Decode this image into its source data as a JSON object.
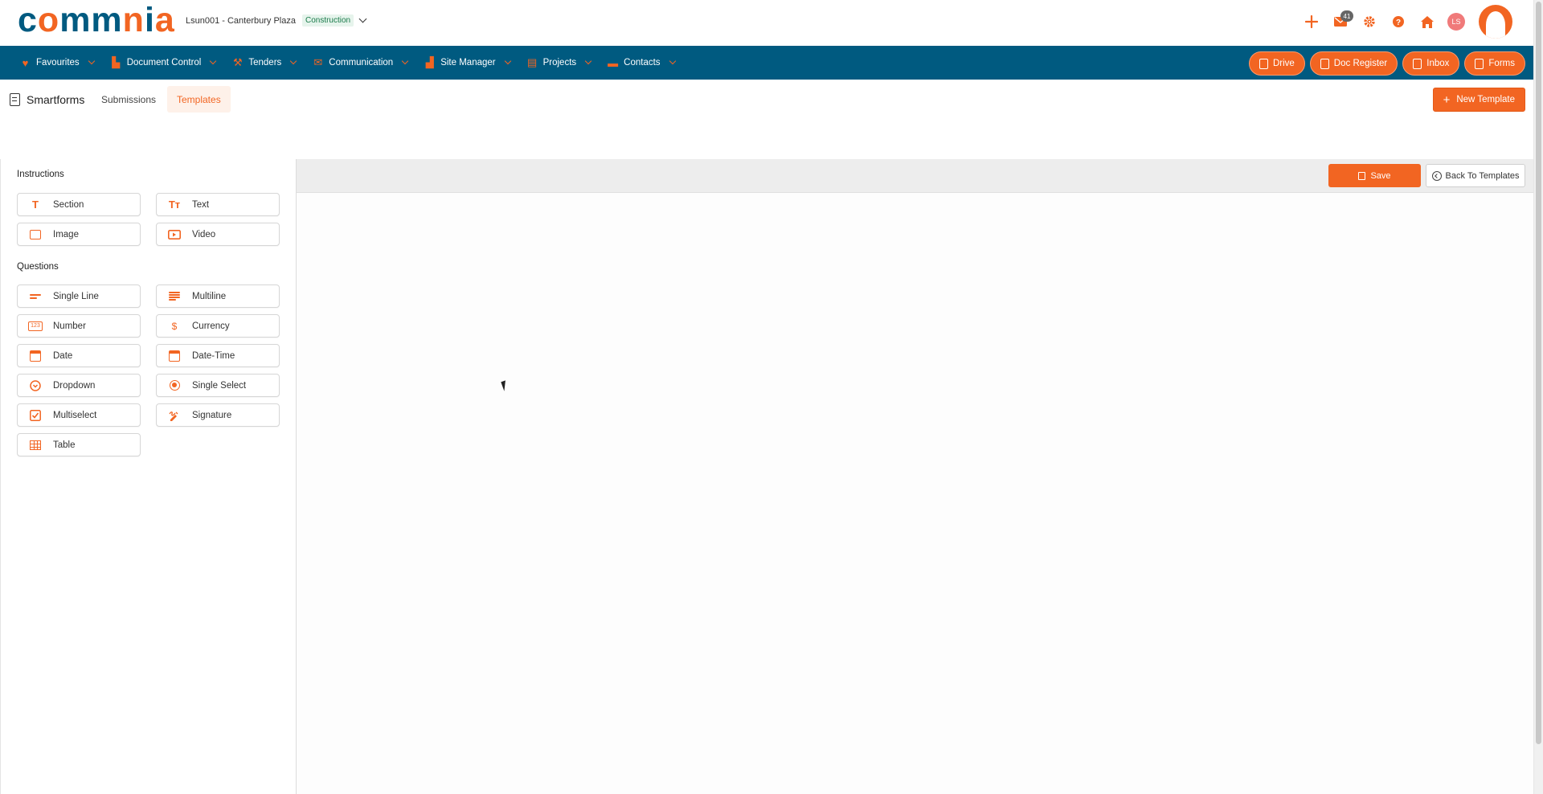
{
  "header": {
    "logo_text": "commnia",
    "project_label": "Lsun001 - Canterbury Plaza",
    "project_badge": "Construction",
    "mail_count": "41",
    "user_initials": "LS",
    "colors": {
      "brand_orange": "#f26522",
      "brand_blue": "#005a80"
    },
    "icons": [
      "plus-icon",
      "mail-icon",
      "gear-icon",
      "help-icon",
      "home-icon"
    ]
  },
  "nav": {
    "items": [
      {
        "label": "Favourites",
        "icon": "heart-icon"
      },
      {
        "label": "Document Control",
        "icon": "stamp-icon"
      },
      {
        "label": "Tenders",
        "icon": "gavel-icon"
      },
      {
        "label": "Communication",
        "icon": "envelope-icon"
      },
      {
        "label": "Site Manager",
        "icon": "building-icon"
      },
      {
        "label": "Projects",
        "icon": "projects-icon"
      },
      {
        "label": "Contacts",
        "icon": "contacts-icon"
      }
    ],
    "actions": [
      {
        "label": "Drive",
        "icon": "drive-icon"
      },
      {
        "label": "Doc Register",
        "icon": "register-icon"
      },
      {
        "label": "Inbox",
        "icon": "inbox-icon"
      },
      {
        "label": "Forms",
        "icon": "forms-icon"
      }
    ]
  },
  "subheader": {
    "title": "Smartforms",
    "tabs": [
      "Submissions",
      "Templates"
    ],
    "active_tab": "Templates",
    "new_template_label": "New Template"
  },
  "palette": {
    "instructions_heading": "Instructions",
    "instructions": [
      {
        "label": "Section",
        "icon": "section-icon"
      },
      {
        "label": "Text",
        "icon": "text-icon"
      },
      {
        "label": "Image",
        "icon": "image-icon"
      },
      {
        "label": "Video",
        "icon": "video-icon"
      }
    ],
    "questions_heading": "Questions",
    "questions": [
      {
        "label": "Single Line",
        "icon": "single-line-icon"
      },
      {
        "label": "Multiline",
        "icon": "multiline-icon"
      },
      {
        "label": "Number",
        "icon": "number-icon",
        "icon_text": "123"
      },
      {
        "label": "Currency",
        "icon": "currency-icon",
        "icon_text": "$"
      },
      {
        "label": "Date",
        "icon": "date-icon"
      },
      {
        "label": "Date-Time",
        "icon": "date-time-icon"
      },
      {
        "label": "Dropdown",
        "icon": "dropdown-icon"
      },
      {
        "label": "Single Select",
        "icon": "single-select-icon"
      },
      {
        "label": "Multiselect",
        "icon": "multiselect-icon"
      },
      {
        "label": "Signature",
        "icon": "signature-icon"
      },
      {
        "label": "Table",
        "icon": "table-icon"
      }
    ]
  },
  "canvas": {
    "save_label": "Save",
    "back_label": "Back To Templates"
  }
}
